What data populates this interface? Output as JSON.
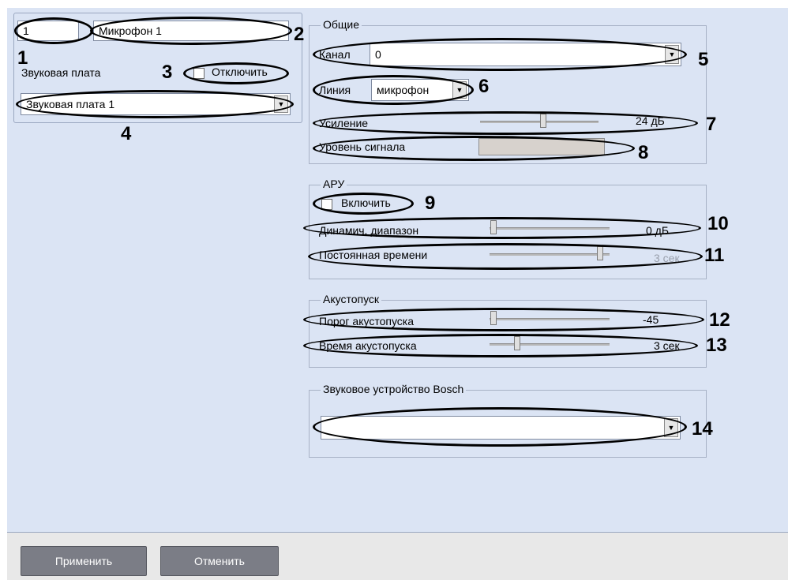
{
  "device": {
    "id_value": "1",
    "name_value": "Микрофон 1"
  },
  "sound_card": {
    "label": "Звуковая плата",
    "disable_label": "Отключить",
    "select_value": "Звуковая плата 1"
  },
  "general": {
    "title": "Общие",
    "channel_label": "Канал",
    "channel_value": "0",
    "line_label": "Линия",
    "line_value": "микрофон",
    "gain_label": "Усиление",
    "gain_value": "24 дБ",
    "gain_slider_fraction": 0.5,
    "signal_label": "Уровень сигнала",
    "signal_level_fraction": 0
  },
  "agc": {
    "title": "АРУ",
    "enable_label": "Включить",
    "dynamic_label": "Динамич. диапазон",
    "dynamic_value": "0 дБ",
    "dynamic_slider_fraction": 0,
    "time_label": "Постоянная времени",
    "time_value": "3 сек",
    "time_slider_fraction": 0.95
  },
  "acoustic": {
    "title": "Акустопуск",
    "threshold_label": "Порог акустопуска",
    "threshold_value": "-45",
    "threshold_slider_fraction": 0,
    "time_label": "Время акустопуска",
    "time_value": "3 сек",
    "time_slider_fraction": 0.2
  },
  "bosch": {
    "title": "Звуковое устройство Bosch",
    "select_value": ""
  },
  "footer": {
    "apply_label": "Применить",
    "cancel_label": "Отменить"
  },
  "callouts": [
    "1",
    "2",
    "3",
    "4",
    "5",
    "6",
    "7",
    "8",
    "9",
    "10",
    "11",
    "12",
    "13",
    "14"
  ]
}
